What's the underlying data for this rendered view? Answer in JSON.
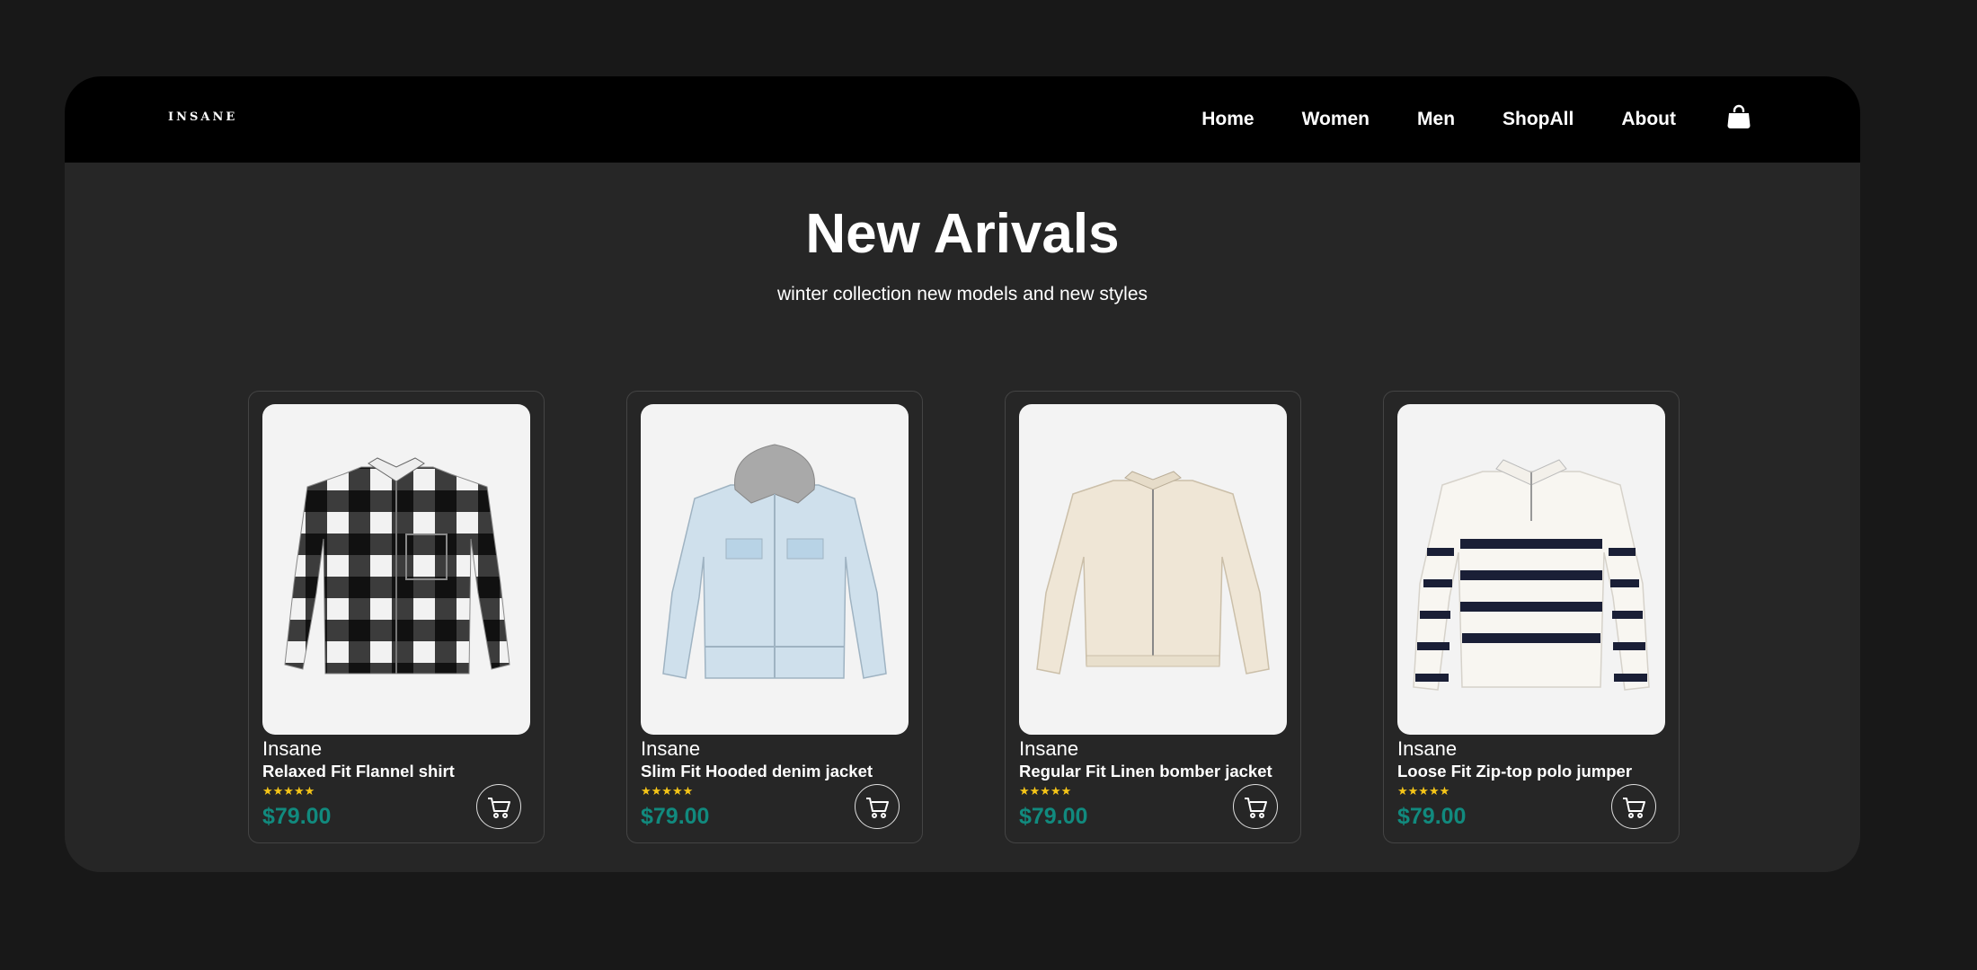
{
  "brand": {
    "logo": "INSANE"
  },
  "nav": {
    "items": [
      {
        "label": "Home"
      },
      {
        "label": "Women"
      },
      {
        "label": "Men"
      },
      {
        "label": "ShopAll"
      },
      {
        "label": "About"
      }
    ],
    "bag_icon": "shopping-bag-icon"
  },
  "hero": {
    "title": "New Arivals",
    "subtitle": "winter collection new models and new styles"
  },
  "products": [
    {
      "brand": "Insane",
      "name": "Relaxed Fit Flannel shirt",
      "rating": "★★★★★",
      "price": "$79.00",
      "image": "flannel-shirt"
    },
    {
      "brand": "Insane",
      "name": "Slim Fit Hooded denim jacket",
      "rating": "★★★★★",
      "price": "$79.00",
      "image": "denim-jacket"
    },
    {
      "brand": "Insane",
      "name": "Regular Fit Linen bomber jacket",
      "rating": "★★★★★",
      "price": "$79.00",
      "image": "bomber-jacket"
    },
    {
      "brand": "Insane",
      "name": "Loose Fit Zip-top polo jumper",
      "rating": "★★★★★",
      "price": "$79.00",
      "image": "polo-jumper"
    }
  ],
  "colors": {
    "page_bg": "#181818",
    "frame_bg": "#262626",
    "navbar_bg": "#000000",
    "price": "#118a7e",
    "stars": "#f5c518"
  }
}
